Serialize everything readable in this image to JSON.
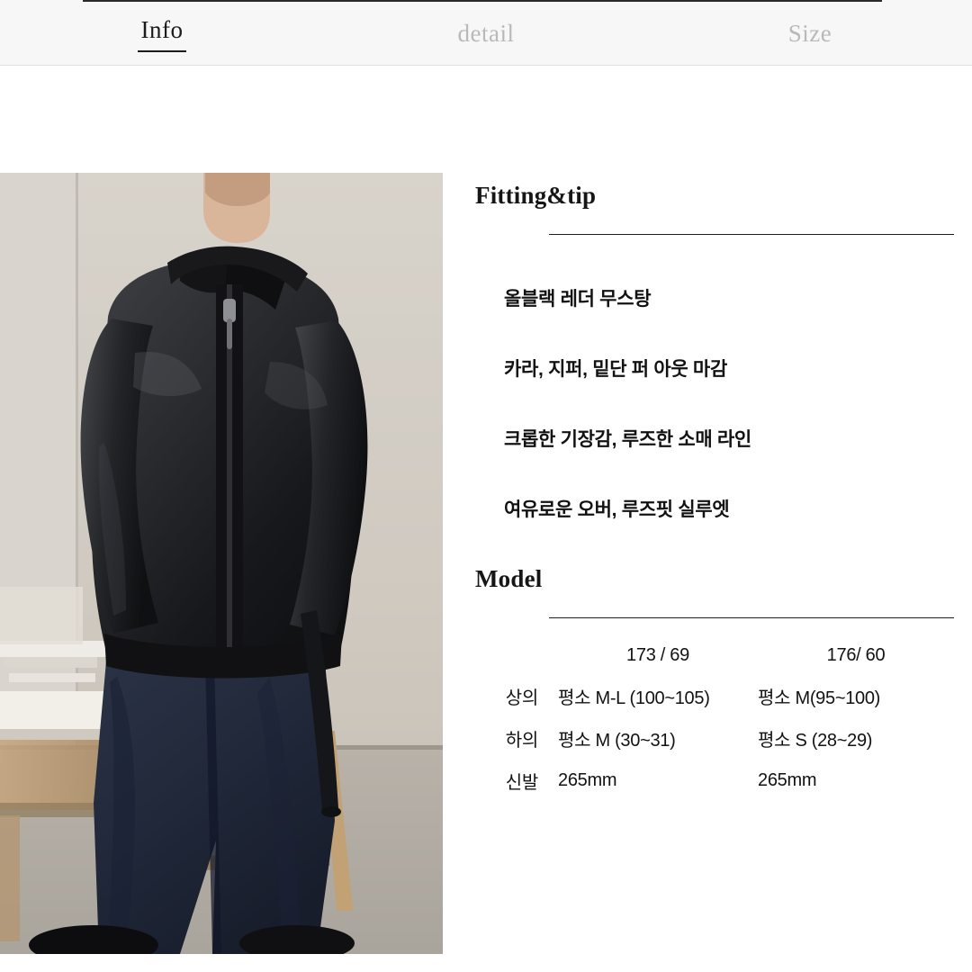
{
  "tabs": [
    {
      "label": "Info",
      "active": true
    },
    {
      "label": "detail",
      "active": false
    },
    {
      "label": "Size",
      "active": false
    }
  ],
  "fitting": {
    "title": "Fitting&tip",
    "bullets": [
      "올블랙 레더 무스탕",
      "카라, 지퍼, 밑단 퍼 아웃 마감",
      "크롭한 기장감, 루즈한 소매 라인",
      "여유로운 오버, 루즈핏 실루엣"
    ]
  },
  "model": {
    "title": "Model",
    "columns": [
      "173 / 69",
      "176/ 60"
    ],
    "rows": [
      {
        "label": "상의",
        "a": "평소 M-L (100~105)",
        "b": "평소 M(95~100)"
      },
      {
        "label": "하의",
        "a": "평소 M (30~31)",
        "b": "평소 S (28~29)"
      },
      {
        "label": "신발",
        "a": "265mm",
        "b": "265mm"
      }
    ]
  },
  "photo": {
    "alt": "model-wearing-black-leather-mustang-jacket-and-dark-denim-jeans"
  },
  "colors": {
    "accent": "#1b1b1b",
    "inactive_tab": "#b9b9b9",
    "tabbar_bg": "#f7f7f7"
  }
}
